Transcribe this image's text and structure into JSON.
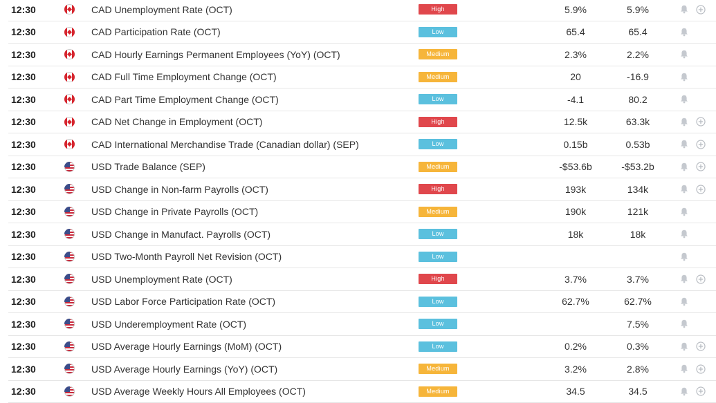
{
  "colors": {
    "High": "#e0474c",
    "Medium": "#f6b53a",
    "Low": "#5bc0de"
  },
  "rows": [
    {
      "time": "12:30",
      "country": "ca",
      "event": "CAD Unemployment Rate (OCT)",
      "impact": "High",
      "actual": "5.9%",
      "forecast": "5.9%",
      "plus": true
    },
    {
      "time": "12:30",
      "country": "ca",
      "event": "CAD Participation Rate (OCT)",
      "impact": "Low",
      "actual": "65.4",
      "forecast": "65.4",
      "plus": false
    },
    {
      "time": "12:30",
      "country": "ca",
      "event": "CAD Hourly Earnings Permanent Employees (YoY) (OCT)",
      "impact": "Medium",
      "actual": "2.3%",
      "forecast": "2.2%",
      "plus": false
    },
    {
      "time": "12:30",
      "country": "ca",
      "event": "CAD Full Time Employment Change (OCT)",
      "impact": "Medium",
      "actual": "20",
      "forecast": "-16.9",
      "plus": false
    },
    {
      "time": "12:30",
      "country": "ca",
      "event": "CAD Part Time Employment Change (OCT)",
      "impact": "Low",
      "actual": "-4.1",
      "forecast": "80.2",
      "plus": false
    },
    {
      "time": "12:30",
      "country": "ca",
      "event": "CAD Net Change in Employment (OCT)",
      "impact": "High",
      "actual": "12.5k",
      "forecast": "63.3k",
      "plus": true
    },
    {
      "time": "12:30",
      "country": "ca",
      "event": "CAD International Merchandise Trade (Canadian dollar) (SEP)",
      "impact": "Low",
      "actual": "0.15b",
      "forecast": "0.53b",
      "plus": true
    },
    {
      "time": "12:30",
      "country": "us",
      "event": "USD Trade Balance (SEP)",
      "impact": "Medium",
      "actual": "-$53.6b",
      "forecast": "-$53.2b",
      "plus": true
    },
    {
      "time": "12:30",
      "country": "us",
      "event": "USD Change in Non-farm Payrolls (OCT)",
      "impact": "High",
      "actual": "193k",
      "forecast": "134k",
      "plus": true
    },
    {
      "time": "12:30",
      "country": "us",
      "event": "USD Change in Private Payrolls (OCT)",
      "impact": "Medium",
      "actual": "190k",
      "forecast": "121k",
      "plus": false
    },
    {
      "time": "12:30",
      "country": "us",
      "event": "USD Change in Manufact. Payrolls (OCT)",
      "impact": "Low",
      "actual": "18k",
      "forecast": "18k",
      "plus": false
    },
    {
      "time": "12:30",
      "country": "us",
      "event": "USD Two-Month Payroll Net Revision (OCT)",
      "impact": "Low",
      "actual": "",
      "forecast": "",
      "plus": false
    },
    {
      "time": "12:30",
      "country": "us",
      "event": "USD Unemployment Rate (OCT)",
      "impact": "High",
      "actual": "3.7%",
      "forecast": "3.7%",
      "plus": true
    },
    {
      "time": "12:30",
      "country": "us",
      "event": "USD Labor Force Participation Rate (OCT)",
      "impact": "Low",
      "actual": "62.7%",
      "forecast": "62.7%",
      "plus": false
    },
    {
      "time": "12:30",
      "country": "us",
      "event": "USD Underemployment Rate (OCT)",
      "impact": "Low",
      "actual": "",
      "forecast": "7.5%",
      "plus": false
    },
    {
      "time": "12:30",
      "country": "us",
      "event": "USD Average Hourly Earnings (MoM) (OCT)",
      "impact": "Low",
      "actual": "0.2%",
      "forecast": "0.3%",
      "plus": true
    },
    {
      "time": "12:30",
      "country": "us",
      "event": "USD Average Hourly Earnings (YoY) (OCT)",
      "impact": "Medium",
      "actual": "3.2%",
      "forecast": "2.8%",
      "plus": true
    },
    {
      "time": "12:30",
      "country": "us",
      "event": "USD Average Weekly Hours All Employees (OCT)",
      "impact": "Medium",
      "actual": "34.5",
      "forecast": "34.5",
      "plus": true
    }
  ]
}
